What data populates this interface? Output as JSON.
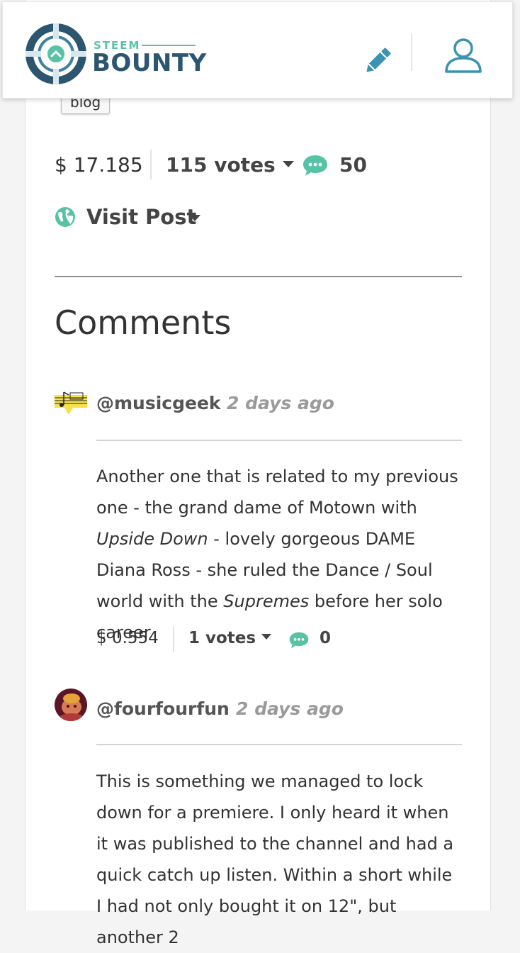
{
  "header": {
    "brand_top": "STEEM",
    "brand_main": "BOUNTY"
  },
  "post": {
    "tag": "blog",
    "payout": "$ 17.185",
    "votes": "115 votes",
    "comments_count": "50",
    "visit_label": "Visit Post"
  },
  "comments_section": {
    "title": "Comments"
  },
  "comments": [
    {
      "author": "@musicgeek",
      "time": "2 days ago",
      "body_parts": [
        "Another one that is related to my previous one - the grand dame of Motown with ",
        "Upside Down",
        " - lovely gorgeous DAME Diana Ross - she ruled the Dance / Soul world with the ",
        "Supremes",
        " before her solo career"
      ],
      "payout": "$ 0.554",
      "votes": "1 votes",
      "replies": "0"
    },
    {
      "author": "@fourfourfun",
      "time": "2 days ago",
      "body": "This is something we managed to lock down for a premiere. I only heard it when it was published to the channel and had a quick catch up listen. Within a short while I had not only bought it on 12\", but another 2"
    }
  ],
  "colors": {
    "accent_green": "#56c3a4",
    "brand_navy": "#2c5670",
    "icon_blue": "#3a93b3"
  }
}
